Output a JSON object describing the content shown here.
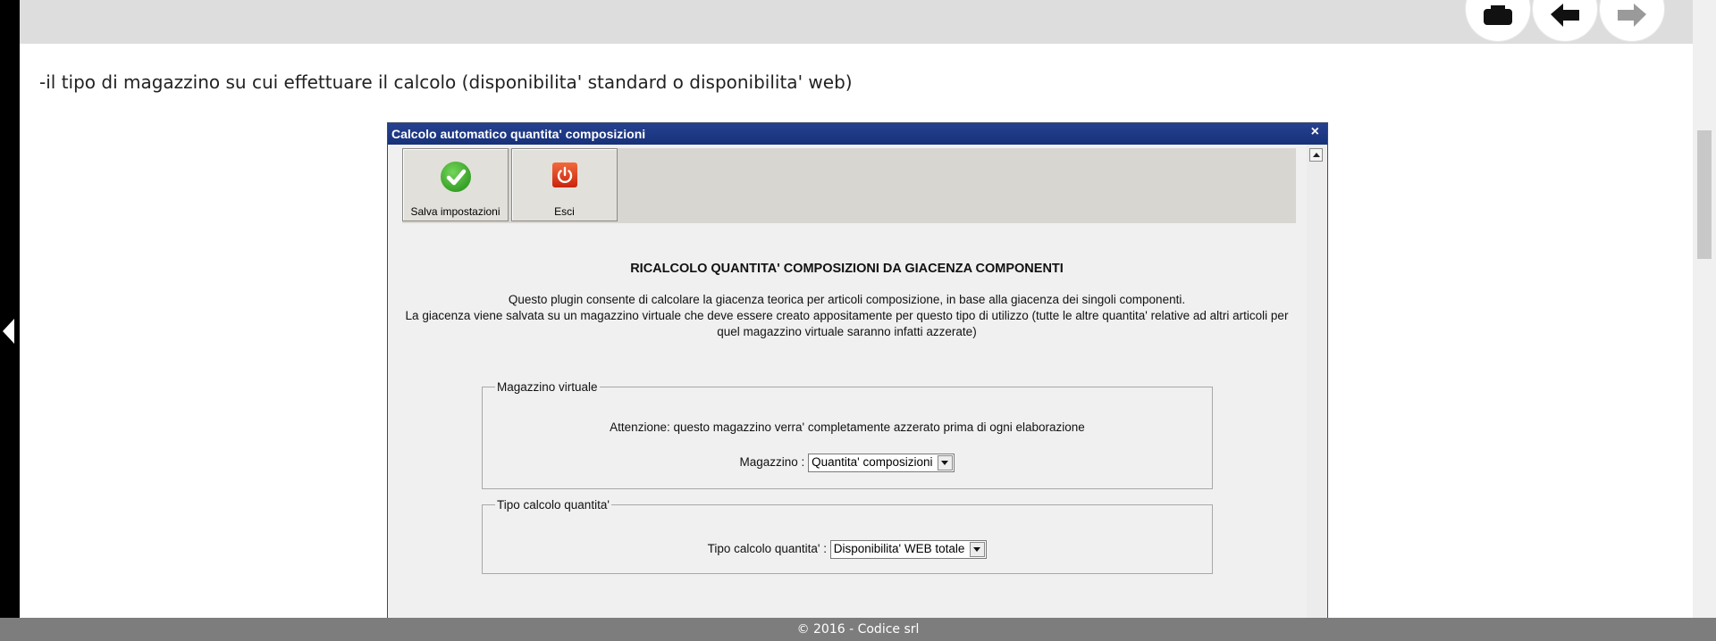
{
  "intro_text": "-il tipo di magazzino su cui effettuare il calcolo (disponibilita' standard o disponibilita' web)",
  "nav": {
    "icons": [
      "print-icon",
      "back-arrow-icon",
      "forward-arrow-icon"
    ]
  },
  "dialog": {
    "title": "Calcolo automatico quantita' composizioni",
    "close": "×",
    "toolbar": {
      "save_label": "Salva impostazioni",
      "exit_label": "Esci"
    },
    "heading": "RICALCOLO QUANTITA' COMPOSIZIONI DA GIACENZA COMPONENTI",
    "desc_line1": "Questo plugin consente di calcolare la giacenza teorica per articoli composizione, in base alla giacenza dei singoli componenti.",
    "desc_line2": "La giacenza viene salvata su un magazzino virtuale che deve essere creato appositamente per questo tipo di utilizzo (tutte le altre quantita' relative ad altri articoli per quel magazzino virtuale saranno infatti azzerate)",
    "group_virtual": {
      "legend": "Magazzino virtuale",
      "warning": "Attenzione: questo magazzino verra' completamente azzerato prima di ogni elaborazione",
      "label": "Magazzino :",
      "value": "Quantita' composizioni"
    },
    "group_calc": {
      "legend": "Tipo calcolo quantita'",
      "label": "Tipo calcolo quantita' :",
      "value": "Disponibilita' WEB totale"
    }
  },
  "footer": "© 2016 - Codice srl"
}
